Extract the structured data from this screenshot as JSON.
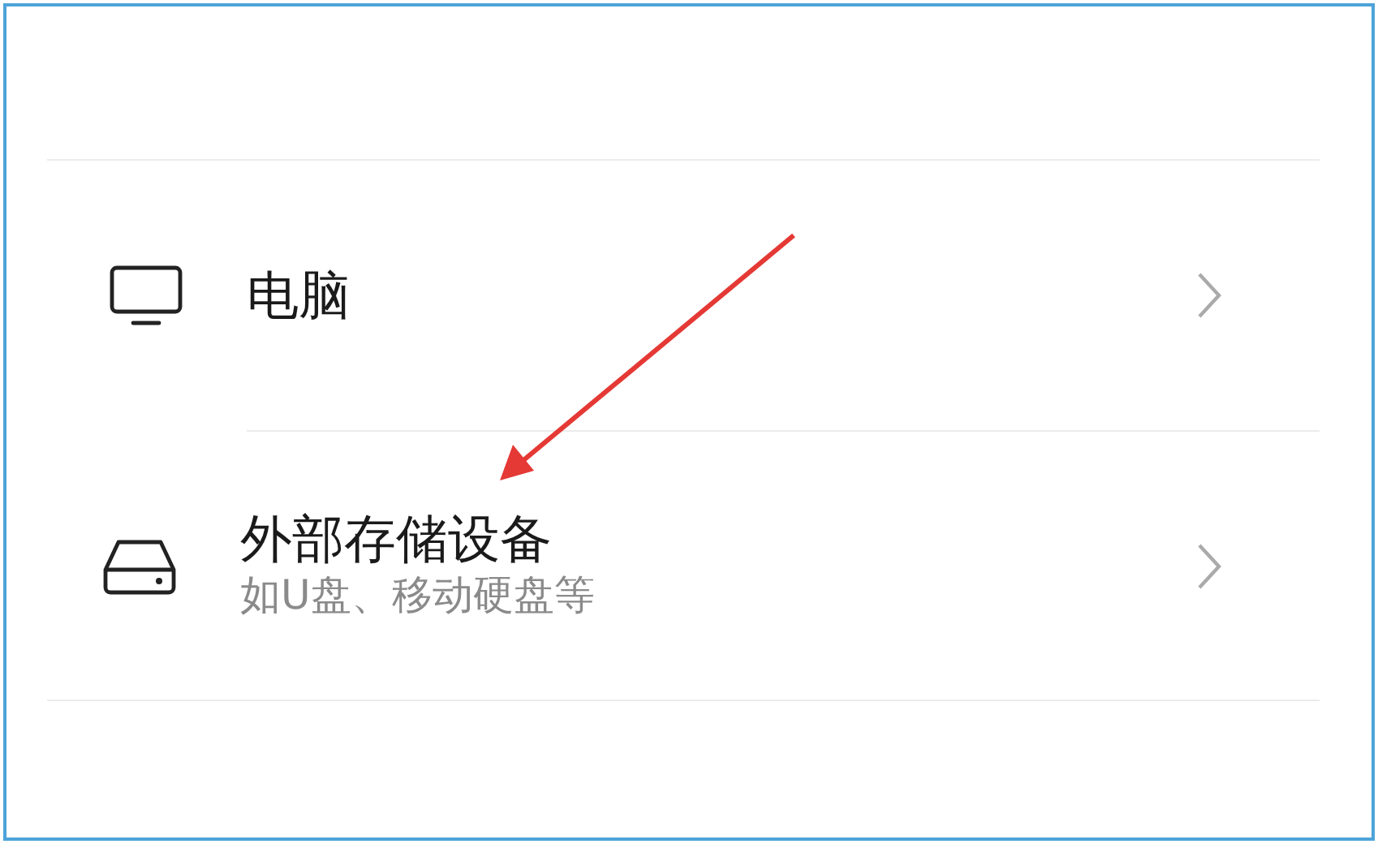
{
  "rows": [
    {
      "kind": "computer",
      "title": "电脑"
    },
    {
      "kind": "storage",
      "title": "外部存储设备",
      "subtitle": "如U盘、移动硬盘等"
    }
  ]
}
